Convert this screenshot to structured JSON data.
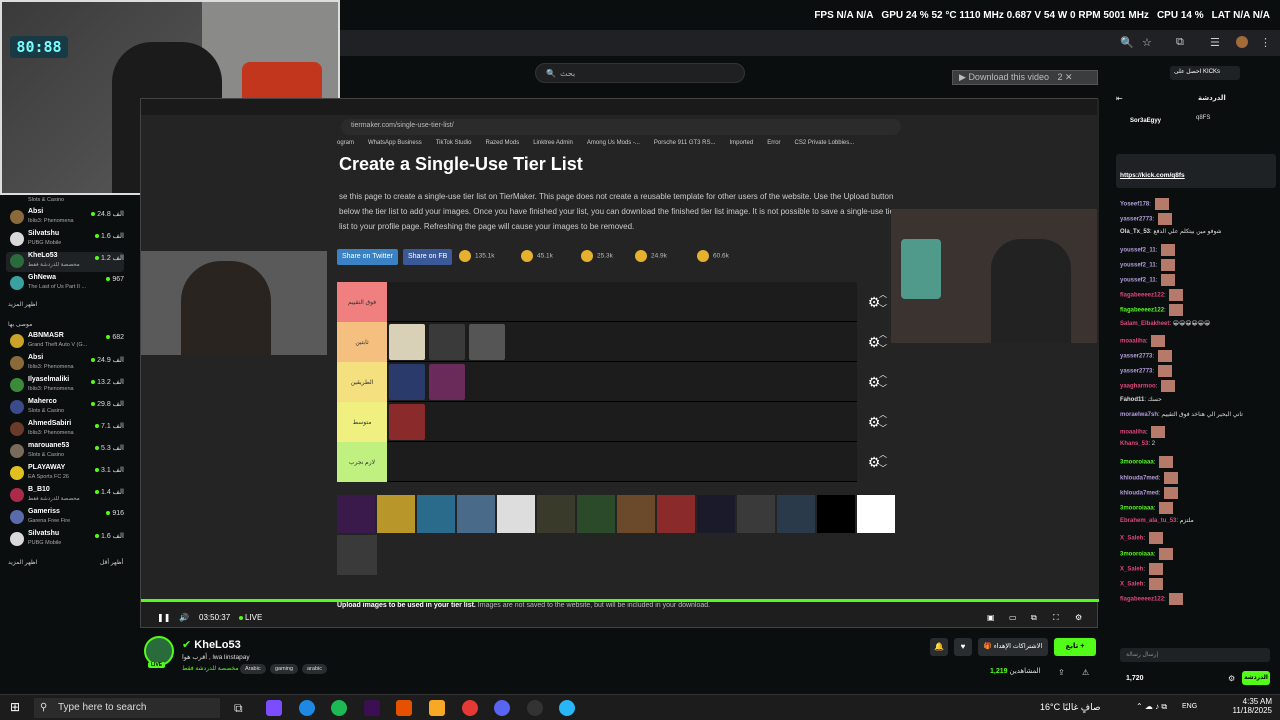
{
  "osd": {
    "fps_label": "FPS",
    "fps_value": "N/A",
    "fps_value2": "N/A",
    "gpu_label": "GPU",
    "gpu_pct": "24 %",
    "gpu_temp": "52 °C",
    "gpu_clock": "1110 MHz",
    "gpu_volt": "0.687 V",
    "gpu_power": "54 W",
    "gpu_fan": "0 RPM",
    "gpu_mem": "5001 MHz",
    "cpu_label": "CPU",
    "cpu_pct": "14 %",
    "lat_label": "LAT",
    "lat_value": "N/A",
    "lat_value2": "N/A"
  },
  "browser": {
    "search_placeholder": "بحث"
  },
  "webcam": {
    "clock": "80:88"
  },
  "sidebar": {
    "items_top": [
      {
        "cat": "Slots & Casino"
      },
      {
        "name": "Absi",
        "cat": "Iblis3: Phenomena",
        "viewers": "24.8 الف",
        "color": "#8a6a3a"
      },
      {
        "name": "Silvatshu",
        "cat": "PUBG Mobile",
        "viewers": "1.6 الف",
        "color": "#d9d9d9"
      },
      {
        "name": "KheLo53",
        "cat": "مخصصة للدردشة فقط",
        "viewers": "1.2 الف",
        "color": "#2a6b3b"
      },
      {
        "name": "GhNewa",
        "cat": "The Last of Us Part II ...",
        "viewers": "967",
        "color": "#3aa0a0"
      }
    ],
    "more1": "اظهر المزيد",
    "section2": "موصى بها",
    "items_rec": [
      {
        "name": "ABNMASR",
        "cat": "Grand Theft Auto V (G...",
        "viewers": "682",
        "color": "#c9a227"
      },
      {
        "name": "Absi",
        "cat": "Iblis3: Phenomena",
        "viewers": "24.9 الف",
        "color": "#8a6a3a"
      },
      {
        "name": "Ilyaselmaliki",
        "cat": "Iblis3: Phenomena",
        "viewers": "13.2 الف",
        "color": "#3a8a3a"
      },
      {
        "name": "Maherco",
        "cat": "Slots & Casino",
        "viewers": "29.8 الف",
        "color": "#3a4a8a"
      },
      {
        "name": "AhmedSabiri",
        "cat": "Iblis3: Phenomena",
        "viewers": "7.1 الف",
        "color": "#6a3a2a"
      },
      {
        "name": "marouane53",
        "cat": "Slots & Casino",
        "viewers": "5.3 الف",
        "color": "#7a6a5a"
      },
      {
        "name": "PLAYAWAY",
        "cat": "EA Sports FC 26",
        "viewers": "3.1 الف",
        "color": "#e0c020"
      },
      {
        "name": "B_B10",
        "cat": "مخصصة للدردشة فقط",
        "viewers": "1.4 الف",
        "color": "#aa2a4a"
      },
      {
        "name": "Gameriss",
        "cat": "Garena Free Fire",
        "viewers": "916",
        "color": "#5a6aaa"
      },
      {
        "name": "Silvatshu",
        "cat": "PUBG Mobile",
        "viewers": "1.6 الف",
        "color": "#d9d9d9"
      }
    ],
    "more2": "اظهر المزيد",
    "less": "أظهر أقل"
  },
  "video": {
    "tm_url": "tiermaker.com/single-use-tier-list/",
    "bookmarks": [
      "ogram",
      "WhatsApp Business",
      "TikTok Studio",
      "Razed Mods",
      "Linktree Admin",
      "Among Us Mods -...",
      "Porsche 911 GT3 RS...",
      "Imported",
      "Error",
      "CS2 Private Lobbies..."
    ],
    "title": "Create a Single-Use Tier List",
    "desc": "se this page to create a single-use tier list on TierMaker. This page does not create a reusable template for other users of the website. Use the Upload button below the tier list to add your images. Once you have finished your list, you can download the finished tier list image. It is not possible to save a single-use tier list to your profile page. Refreshing the page will cause your images to be removed.",
    "share_twitter": "Share on Twitter",
    "share_fb": "Share on FB",
    "reactions": [
      "135.1k",
      "45.1k",
      "25.3k",
      "24.9k",
      "60.6k"
    ],
    "tiers": [
      {
        "label": "فوق التقييم",
        "color": "#f08080"
      },
      {
        "label": "ثابتين",
        "color": "#f5bf80"
      },
      {
        "label": "الطريقين",
        "color": "#f5e080"
      },
      {
        "label": "متوسط",
        "color": "#f0f080"
      },
      {
        "label": "لازم نجرب",
        "color": "#c0f080"
      }
    ],
    "upload_bold": "Upload images to be used in your tier list.",
    "upload_rest": " Images are not saved to the website, but will be included in your download.",
    "time": "03:50:37",
    "live": "LIVE"
  },
  "channel": {
    "name": "KheLo53",
    "title": "أقرب هوا , lwa linstapay",
    "category": "مخصصة للدردشة فقط",
    "tags": [
      "Arabic",
      "gaming",
      "arabic"
    ],
    "live": "LIVE",
    "follow": "تابع",
    "subs": "الاشتراكات الإهداء",
    "viewers_label": "المشاهدين",
    "viewers": "1,219"
  },
  "topright": {
    "download": "Download this video",
    "download_count": "2",
    "kick_get": "احصل على KICKs"
  },
  "chat": {
    "header": "الدردشة",
    "pinned_user": "Sor3aEgyy",
    "pinned_sub": "q8FS",
    "pinned_link": "https://kick.com/q8fs",
    "lines": [
      {
        "u": "Yoseef178",
        "t": "",
        "c": "#b39ddb",
        "e": true
      },
      {
        "u": "yasser2773",
        "t": "",
        "c": "#b39ddb",
        "e": true
      },
      {
        "u": "Ola_Tx_53",
        "t": "شوفو مين بيتكلم علي الدفع",
        "c": "#ddd",
        "e": false
      },
      {
        "u": "youssef2_11",
        "t": "",
        "c": "#b39ddb",
        "e": true
      },
      {
        "u": "youssef2_11",
        "t": "",
        "c": "#b39ddb",
        "e": true
      },
      {
        "u": "youssef2_11",
        "t": "",
        "c": "#b39ddb",
        "e": true
      },
      {
        "u": "flagabeeeez122",
        "t": "",
        "c": "#e0457b",
        "e": true
      },
      {
        "u": "flagabeeeez122",
        "t": "",
        "c": "#53fc18",
        "e": true
      },
      {
        "u": "Salam_Elbakheet",
        "t": "😀😀😀😀😀😀",
        "c": "#e0457b",
        "e": false
      },
      {
        "u": "moaaliha",
        "t": "",
        "c": "#e0457b",
        "e": true
      },
      {
        "u": "yasser2773",
        "t": "",
        "c": "#b39ddb",
        "e": true
      },
      {
        "u": "yasser2773",
        "t": "",
        "c": "#b39ddb",
        "e": true
      },
      {
        "u": "yaagharmoo",
        "t": "",
        "c": "#e0457b",
        "e": true
      },
      {
        "u": "Fahod11",
        "t": "حسك",
        "c": "#ddd",
        "e": false
      },
      {
        "u": "moraelwa7sh",
        "t": "تاني البحير الي هناخد فوق التقييم",
        "c": "#b39ddb",
        "e": false
      },
      {
        "u": "moaaliha",
        "t": "",
        "c": "#e0457b",
        "e": true
      },
      {
        "u": "Khans_53",
        "t": "2",
        "c": "#e0457b",
        "e": false
      },
      {
        "u": "3mooroiaaa",
        "t": "",
        "c": "#53fc18",
        "e": true
      },
      {
        "u": "khlouda7med",
        "t": "",
        "c": "#b39ddb",
        "e": true
      },
      {
        "u": "khlouda7med",
        "t": "",
        "c": "#b39ddb",
        "e": true
      },
      {
        "u": "3mooroiaaa",
        "t": "",
        "c": "#53fc18",
        "e": true
      },
      {
        "u": "Ebrahem_ala_tu_53",
        "t": "ملتزم",
        "c": "#e0457b",
        "e": false
      },
      {
        "u": "X_Saleh",
        "t": "",
        "c": "#e0457b",
        "e": true
      },
      {
        "u": "3mooroiaaa",
        "t": "",
        "c": "#53fc18",
        "e": true
      },
      {
        "u": "X_Saleh",
        "t": "",
        "c": "#e0457b",
        "e": true
      },
      {
        "u": "X_Saleh",
        "t": "",
        "c": "#e0457b",
        "e": true
      },
      {
        "u": "flagabeeeez122",
        "t": "",
        "c": "#e0457b",
        "e": true
      }
    ],
    "input_placeholder": "إرسال رسالة",
    "send": "الدردشة",
    "points": "1,720"
  },
  "taskbar": {
    "search": "Type here to search",
    "weather": "16°C صافٍ غالبًا",
    "lang": "ENG",
    "time": "4:35 AM",
    "date": "11/18/2025"
  },
  "colors": {
    "accent": "#53fc18",
    "bg": "#0b0e0f"
  }
}
